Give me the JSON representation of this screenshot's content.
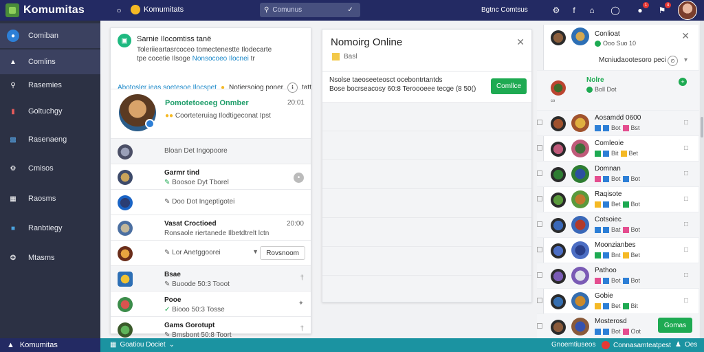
{
  "app": {
    "title": "Komumitas"
  },
  "topbar": {
    "breadcrumb": "Komumitats",
    "search_placeholder": "Comunus",
    "link": "Bgtnc Comtsus",
    "badge_count_1": "1",
    "badge_count_2": "4"
  },
  "sidebar": {
    "items": [
      {
        "label": "Comiban",
        "icon": "community-icon"
      },
      {
        "label": "Comlins",
        "icon": "mountain-icon"
      },
      {
        "label": "Rasemies",
        "icon": "search-icon"
      },
      {
        "label": "Goltuchgy",
        "icon": "chart-icon"
      },
      {
        "label": "Rasenaeng",
        "icon": "group-icon"
      },
      {
        "label": "Cmisos",
        "icon": "gear-icon"
      },
      {
        "label": "Raosms",
        "icon": "calendar-icon"
      },
      {
        "label": "Ranbtiegy",
        "icon": "folder-icon"
      },
      {
        "label": "Mtasms",
        "icon": "globe-icon"
      }
    ]
  },
  "bottombar": {
    "brand": "Komumitas",
    "channel": "Goatiou Dociet",
    "right_1": "Gnoemtiuseos",
    "right_2": "Connasamteatpest",
    "right_3": "Oes"
  },
  "community": {
    "title": "Sarnie Ilocomtiss tanë",
    "desc_1": "Toleriieartasrcoceo tomectenestte Ilodecarte",
    "desc_2_pre": "tpe cocetie Ilsoge",
    "desc_2_hl": "Nonsocoeo Ilocnei",
    "desc_2_post": "tr",
    "link_1": "Abotosler ieas soetesoe Ilocspet",
    "link_2": "Notiersoiog poner",
    "link_3": "tatt",
    "feature": {
      "name": "Pomotetoeoeg Onmber",
      "time": "20:01",
      "sub": "Coorteteruiag Ilodtigeconat Ipst"
    },
    "rows": [
      {
        "only": "Bloan Det Ingopoore"
      },
      {
        "name": "Garmr tind",
        "sub": "Boosoe Dyt Tborel"
      },
      {
        "only": "Doo Dot Ingeptigotei"
      },
      {
        "name": "Vasat Croctioed",
        "sub": "Ronsaole riertanede Ilbetdtrelt lctn",
        "time": "20:00"
      },
      {
        "only": "Lor Anetggoorei",
        "button": "Rovsnoom"
      },
      {
        "name": "Bsae",
        "sub": "Buoode 50:3 Tooot"
      },
      {
        "name": "Pooe",
        "sub": "Biooo 50:3 Tosse"
      },
      {
        "name": "Gams Gorotupt",
        "sub": "Bmsbont 50:8 Toort"
      }
    ]
  },
  "notice": {
    "title": "Nomoirg Online",
    "sub": "Basl",
    "line_1": "Nsolse taeoseeteosct ocebontrtantds",
    "line_2": "Bose bocrseacosy 60:8 Teroooeee tecge (8 50()",
    "button": "Comllce"
  },
  "right": {
    "head_1_name": "Conlioat",
    "head_1_sub": "Ooo Suo 10",
    "head_link": "Mcniudaootesoro peci",
    "head_2_name": "Nolre",
    "head_2_sub": "Boll Dot",
    "rows": [
      {
        "name": "Aosamdd 0600",
        "tags": [
          "Bot",
          "Bst"
        ]
      },
      {
        "name": "Comleoie",
        "tags": [
          "Bit",
          "Bet"
        ]
      },
      {
        "name": "Domnan",
        "tags": [
          "Bot",
          "Bot"
        ]
      },
      {
        "name": "Raqisote",
        "tags": [
          "Bet",
          "Bot"
        ]
      },
      {
        "name": "Cotsoiec",
        "tags": [
          "Bat",
          "Bot"
        ]
      },
      {
        "name": "Moonzianbes",
        "tags": [
          "Bnt",
          "Bet"
        ]
      },
      {
        "name": "Pathoo",
        "tags": [
          "Bot",
          "Bot"
        ]
      },
      {
        "name": "Gobie",
        "tags": [
          "Bet",
          "Bit"
        ]
      },
      {
        "name": "Mosterosd",
        "tags": [
          "Bot",
          "Oot"
        ],
        "button": "Gomas"
      }
    ]
  },
  "colors": {
    "topbar": "#232a63",
    "sidebar": "#2c3144",
    "accent_green": "#1eaa52",
    "bottombar": "#1b93a1",
    "link_blue": "#1a88c9"
  }
}
